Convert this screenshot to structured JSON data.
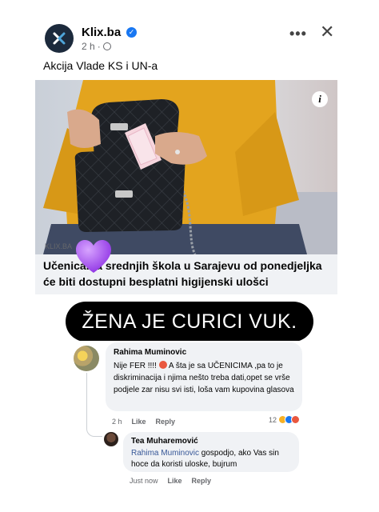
{
  "post": {
    "page_name": "Klix.ba",
    "time": "2 h",
    "separator": "·",
    "text": "Akcija Vlade KS i UN-a",
    "link_domain": "KLIX.BA",
    "link_title": "Učenicama srednjih škola u Sarajevu od ponedjeljka će biti dostupni besplatni higijenski ulošci",
    "icons": [
      "more-icon",
      "close-icon",
      "verified-icon",
      "globe-icon",
      "info-icon",
      "heart-emoji"
    ]
  },
  "caption": "ŽENA JE CURICI VUK.",
  "comment": {
    "author": "Rahima Muminovic",
    "text_1": "Nije FER !!!!",
    "text_2": " A šta je sa UČENICIMA ,pa to je diskriminacija i njima nešto treba dati,opet se vrše podjele zar nisu svi isti, loša vam kupovina glasova",
    "time": "2 h",
    "like": "Like",
    "reply": "Reply",
    "reaction_count": "12"
  },
  "reply": {
    "author": "Tea Muharemović",
    "mention": "Rahima Muminovic",
    "text": " gospodjo, ako Vas sin hoce da koristi uloske, bujrum",
    "time": "Just now",
    "like": "Like",
    "reply": "Reply"
  },
  "colors": {
    "brand_blue": "#1877f2",
    "link_bg": "#f0f2f5",
    "caption_bg": "#000000",
    "heart": "#a855f7"
  }
}
